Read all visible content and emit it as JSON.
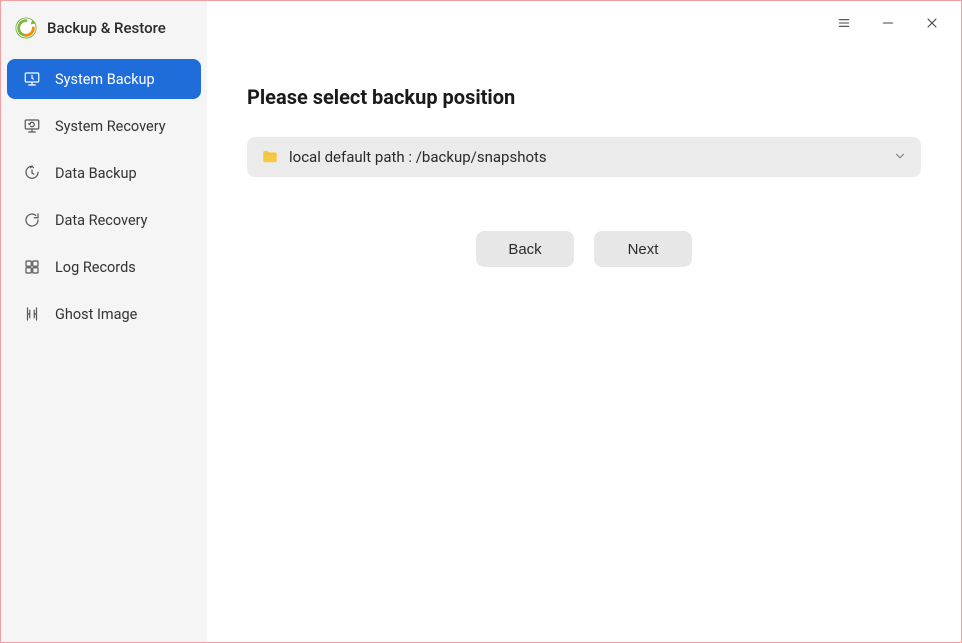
{
  "app": {
    "title": "Backup & Restore"
  },
  "sidebar": {
    "items": [
      {
        "label": "System Backup",
        "active": true
      },
      {
        "label": "System Recovery",
        "active": false
      },
      {
        "label": "Data Backup",
        "active": false
      },
      {
        "label": "Data Recovery",
        "active": false
      },
      {
        "label": "Log Records",
        "active": false
      },
      {
        "label": "Ghost Image",
        "active": false
      }
    ]
  },
  "main": {
    "heading": "Please select backup position",
    "path_label": "local default path : /backup/snapshots",
    "back_label": "Back",
    "next_label": "Next"
  }
}
